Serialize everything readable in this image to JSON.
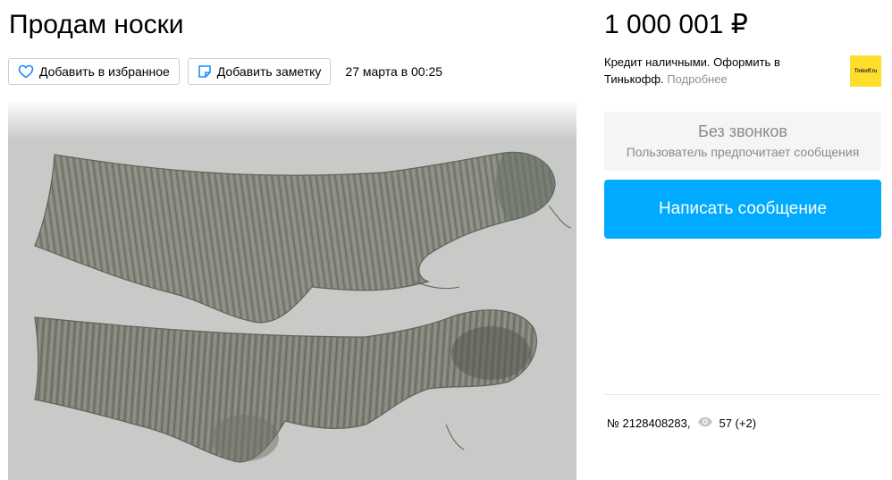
{
  "listing": {
    "title": "Продам носки",
    "date": "27 марта в 00:25",
    "number": "№ 2128408283,",
    "views": "57 (+2)",
    "photo_alt": "socks-photo"
  },
  "actions": {
    "favorite_label": "Добавить в избранное",
    "note_label": "Добавить заметку"
  },
  "sidebar": {
    "price": "1 000 001 ₽",
    "credit_text": "Кредит наличными. Оформить в Тинькофф.",
    "credit_more": "Подробнее",
    "credit_logo_text": "Tinkoff.ru",
    "no_calls_title": "Без звонков",
    "no_calls_subtitle": "Пользователь предпочитает сообщения",
    "message_button": "Написать сообщение"
  },
  "colors": {
    "accent": "#00aaff",
    "tinkoff_yellow": "#ffdd2d",
    "muted_text": "#8f8f8f"
  },
  "icons": {
    "favorite": "heart-icon",
    "note": "note-icon",
    "views": "eye-icon"
  }
}
